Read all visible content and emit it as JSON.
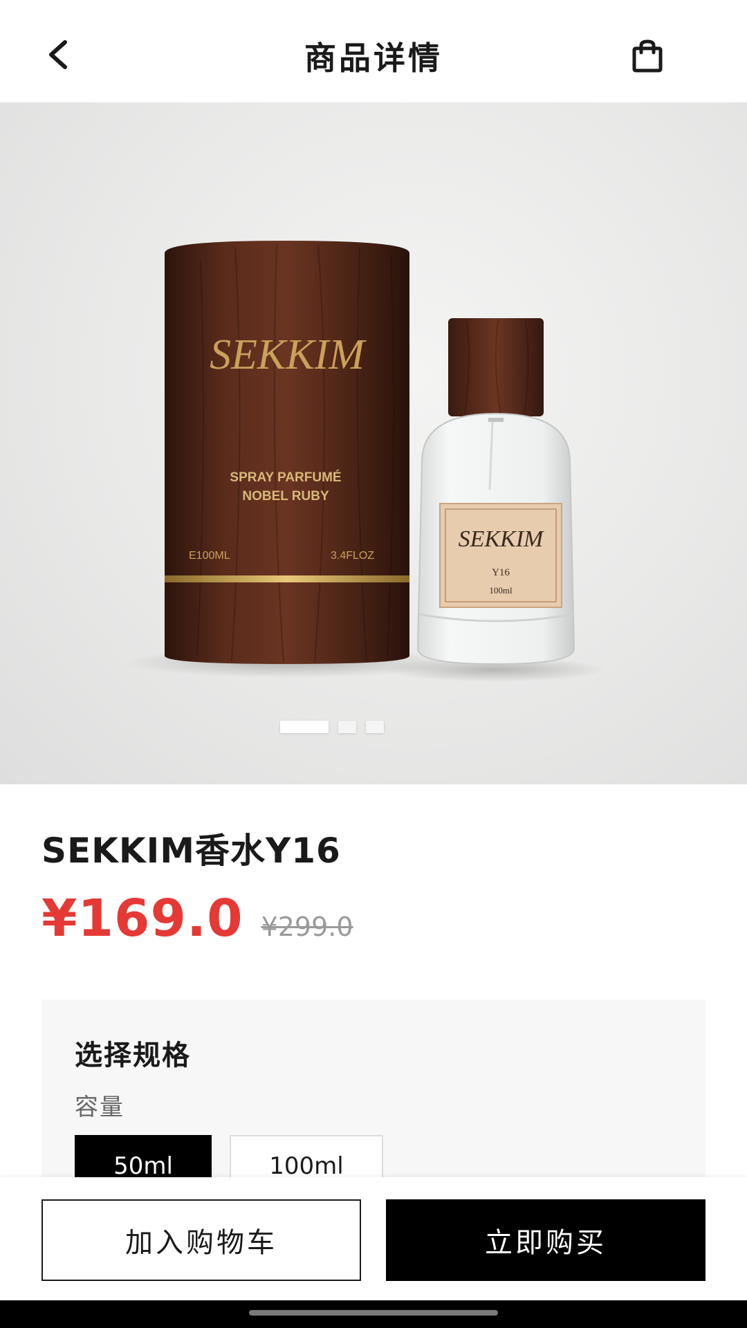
{
  "header": {
    "title": "商品详情",
    "back_icon": "chevron-left-icon",
    "cart_icon": "shopping-bag-icon"
  },
  "product_image": {
    "box_brand": "SEKKIM",
    "box_line1": "SPRAY PARFUMÉ",
    "box_line2": "NOBEL RUBY",
    "box_volume_left": "E100ML",
    "box_volume_right": "3.4FLOZ",
    "label_brand": "SEKKIM",
    "label_code": "Y16",
    "label_volume": "100ml",
    "carousel": {
      "total": 3,
      "active_index": 0
    }
  },
  "product": {
    "name": "SEKKIM香水Y16",
    "price": "¥169.0",
    "original_price": "¥299.0"
  },
  "spec": {
    "title": "选择规格",
    "label": "容量",
    "options": [
      {
        "label": "50ml",
        "selected": true
      },
      {
        "label": "100ml",
        "selected": false
      }
    ]
  },
  "actions": {
    "add_to_cart": "加入购物车",
    "buy_now": "立即购买"
  },
  "colors": {
    "price_red": "#e53935",
    "primary_black": "#000000",
    "box_wood": "#4a2418",
    "label_gold": "#c9a15a"
  }
}
